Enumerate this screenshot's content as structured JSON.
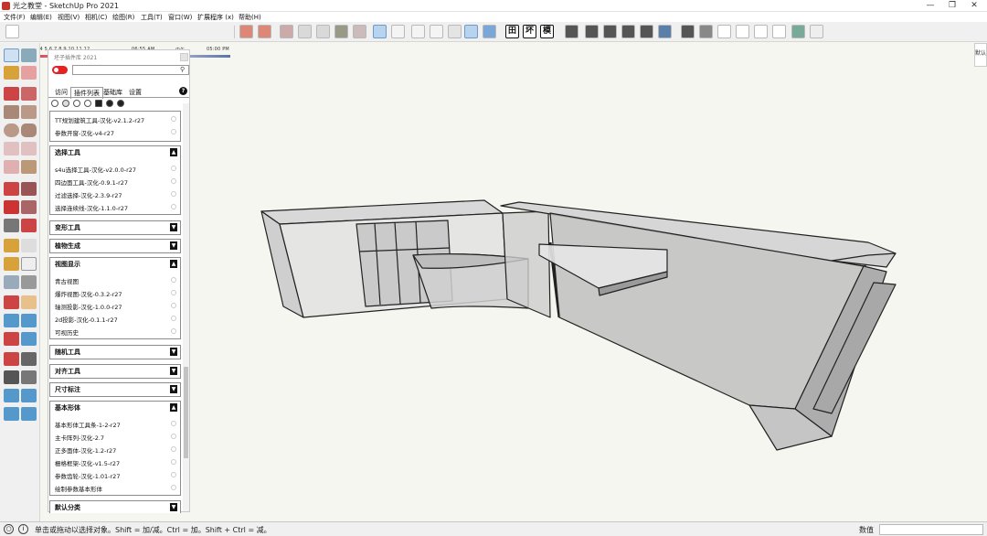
{
  "window": {
    "title": "光之教堂 - SketchUp Pro 2021",
    "minimize": "—",
    "maximize": "❐",
    "close": "✕"
  },
  "menu": [
    "文件(F)",
    "编辑(E)",
    "视图(V)",
    "相机(C)",
    "绘图(R)",
    "工具(T)",
    "窗口(W)",
    "扩展程序 (x)",
    "帮助(H)"
  ],
  "timeline": {
    "months": "1 2 3 4 5 6 7 8 9 10 11 12",
    "time_start": "06:55 AM",
    "noon": "中午",
    "time_end": "05:00 PM"
  },
  "toolbar": {
    "letter_buttons": [
      "田",
      "坏",
      "模"
    ]
  },
  "panel": {
    "title": "坯子插件库 2021",
    "search_placeholder": "",
    "tabs": [
      "访问",
      "插件列表",
      "基础库",
      "设置"
    ],
    "help": "?",
    "sections": [
      {
        "header": "",
        "items": [
          "TT规划建筑工具-汉化-v2.1.2-r27",
          "参数开窗-汉化-v4-r27"
        ]
      },
      {
        "header": "选择工具",
        "items": [
          "s4u选择工具-汉化-v2.0.0-r27",
          "四边面工具-汉化-0.9.1-r27",
          "过滤选择-汉化-2.3.9-r27",
          "选择连续线-汉化-1.1.0-r27"
        ]
      },
      {
        "header": "变形工具",
        "items": []
      },
      {
        "header": "植物生成",
        "items": []
      },
      {
        "header": "视图显示",
        "items": [
          "青古视图",
          "爆炸视图-汉化-0.3.2-r27",
          "轴测投影-汉化-1.0.0-r27",
          "2d投影-汉化-0.1.1-r27",
          "可视历史"
        ]
      },
      {
        "header": "随机工具",
        "items": []
      },
      {
        "header": "对齐工具",
        "items": []
      },
      {
        "header": "尺寸标注",
        "items": []
      },
      {
        "header": "基本形体",
        "items": [
          "基本形体工具条-1-2-r27",
          "主卡阵列-汉化-2.7",
          "正多面体-汉化-1.2-r27",
          "栅格框架-汉化-v1.5-r27",
          "参数齿轮-汉化-1.01-r27",
          "绘制参数基本形体"
        ]
      },
      {
        "header": "默认分类",
        "items": []
      }
    ]
  },
  "right_tray": {
    "label": "默认"
  },
  "statusbar": {
    "message": "单击或拖动以选择对象。Shift = 加/减。Ctrl = 加。Shift + Ctrl = 减。",
    "value_label": "数值",
    "value": ""
  },
  "colors": {
    "accent_blue": "#b8d3ee",
    "toggle_red": "#e32323",
    "viewport_bg": "#f6f6f0"
  }
}
